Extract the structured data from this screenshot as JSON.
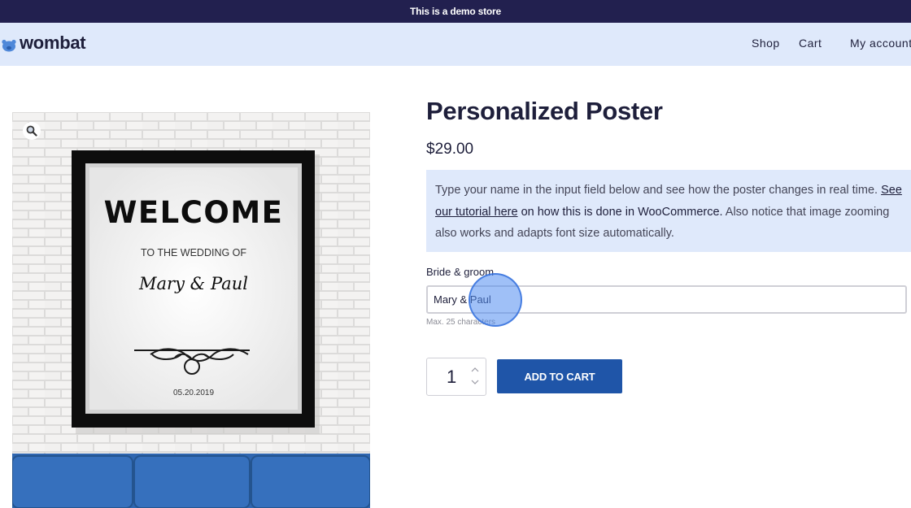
{
  "demo_bar": {
    "text": "This is a demo store"
  },
  "header": {
    "logo_text": "wombat",
    "nav": [
      {
        "label": "Shop"
      },
      {
        "label": "Cart"
      },
      {
        "label": "My account"
      }
    ]
  },
  "gallery": {
    "zoom_icon": "magnifier-icon",
    "poster": {
      "headline": "WELCOME",
      "subline": "TO THE WEDDING OF",
      "names": "Mary & Paul",
      "date": "05.20.2019"
    }
  },
  "product": {
    "title": "Personalized Poster",
    "price": "$29.00",
    "info": {
      "text_before": "Type your name in the input field below and see how the poster changes in real time. ",
      "link_text": "See our tutorial here",
      "text_middle": " on how this is done in WooCommerce.",
      "text_after": " Also notice that image zooming also works and adapts font size automatically."
    },
    "field": {
      "label": "Bride & groom",
      "value": "Mary & Paul",
      "hint": "Max. 25 characters"
    },
    "quantity": "1",
    "add_to_cart_label": "ADD TO CART"
  },
  "colors": {
    "demo_bar_bg": "#22204f",
    "header_bg": "#dfe9fb",
    "button_bg": "#1f55a8",
    "text_dark": "#1e1f3b"
  }
}
